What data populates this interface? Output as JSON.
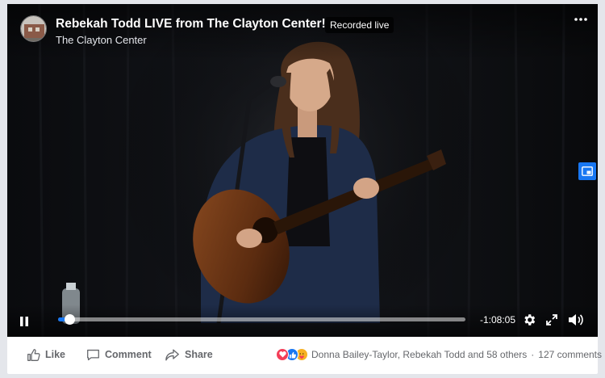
{
  "video": {
    "title": "Rebekah Todd LIVE from The Clayton Center!",
    "badge": "Recorded live",
    "page_name": "The Clayton Center",
    "time_remaining": "-1:08:05",
    "progress_fraction": 0.027
  },
  "actions": {
    "like_label": "Like",
    "comment_label": "Comment",
    "share_label": "Share"
  },
  "reactions": {
    "types": [
      "love-icon",
      "like-icon",
      "care-icon"
    ],
    "reactors_text": "Donna Bailey-Taylor, Rebekah Todd and 58 others",
    "separator": "·",
    "comments_text": "127 comments"
  },
  "colors": {
    "accent": "#1877f2",
    "love": "#f33e58",
    "care": "#f7b125"
  }
}
